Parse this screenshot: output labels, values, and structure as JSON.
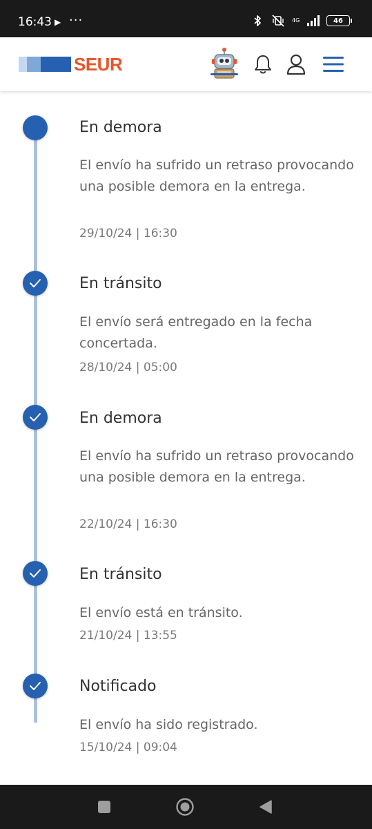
{
  "status_bar": {
    "time": "16:43",
    "network": "4G",
    "battery": "46"
  },
  "header": {
    "brand": "SEUR",
    "colors": {
      "brand": "#e8552b",
      "accent": "#2660b0"
    }
  },
  "events": [
    {
      "title": "En demora",
      "description": "El envío ha sufrido un retraso provocando una posible demora en la entrega.",
      "date": "29/10/24 | 16:30",
      "state": "current",
      "icon": "filled-dot"
    },
    {
      "title": "En tránsito",
      "description": "El envío será entregado en la fecha concertada.",
      "date": "28/10/24 | 05:00",
      "state": "done",
      "icon": "check-icon"
    },
    {
      "title": "En demora",
      "description": "El envío ha sufrido un retraso provocando una posible demora en la entrega.",
      "date": "22/10/24 | 16:30",
      "state": "done",
      "icon": "check-icon"
    },
    {
      "title": "En tránsito",
      "description": "El envío está en tránsito.",
      "date": "21/10/24 | 13:55",
      "state": "done",
      "icon": "check-icon"
    },
    {
      "title": "Notificado",
      "description": "El envío ha sido registrado.",
      "date": "15/10/24 | 09:04",
      "state": "done",
      "icon": "check-icon"
    }
  ]
}
